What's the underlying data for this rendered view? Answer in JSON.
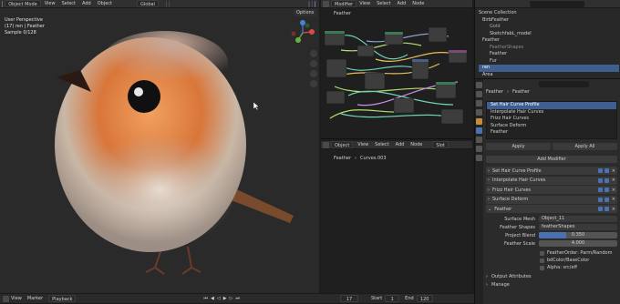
{
  "viewport": {
    "mode": "Object Mode",
    "menu": [
      "View",
      "Select",
      "Add",
      "Object"
    ],
    "transform": "Global",
    "options": "Options",
    "overlay": [
      "User Perspective",
      "(17) ren | Feather",
      "Sample 0/128"
    ]
  },
  "timeline": {
    "labels": [
      "View",
      "Marker",
      "Playback"
    ],
    "frame": "17",
    "start_label": "Start",
    "start": "1",
    "end_label": "End",
    "end": "120"
  },
  "node_editor_top": {
    "mode": "Modifier",
    "menu": [
      "View",
      "Select",
      "Add",
      "Node"
    ],
    "breadcrumb": "Feather"
  },
  "node_editor_bottom": {
    "mode": "Object",
    "menu": [
      "View",
      "Select",
      "Add",
      "Node"
    ],
    "slot": "Slot",
    "breadcrumb_a": "Feather",
    "breadcrumb_b": "Curves.003"
  },
  "outliner": {
    "items": [
      "Scene Collection",
      "BirbFeather",
      "Gold",
      "SketchfabL_model",
      "Feather",
      "FeatherShapes",
      "Feather",
      "Fur",
      "ren",
      "Area"
    ]
  },
  "properties": {
    "crumb_a": "Feather",
    "crumb_b": "Feather",
    "stack": [
      "Set Hair Curve Profile",
      "Interpolate Hair Curves",
      "Frizz Hair Curves",
      "Surface Deform",
      "Feather"
    ],
    "apply": "Apply",
    "apply_all": "Apply All",
    "add_modifier": "Add Modifier",
    "modifiers": [
      "Set Hair Curve Profile",
      "Interpolate Hair Curves",
      "Frizz Hair Curves",
      "Surface Deform",
      "Feather"
    ],
    "fields": [
      {
        "label": "Surface Mesh",
        "value": "Object_11"
      },
      {
        "label": "Feather Shapes",
        "value": "featherShapes"
      },
      {
        "label": "Project Blend",
        "value": "0.350"
      },
      {
        "label": "Feather Scale",
        "value": "4.000"
      }
    ],
    "project_blend_fraction": 0.35,
    "checks": [
      "FeatherOrder: Parm/Random",
      "bdColor/BaseColor",
      "Alpha: src/eff"
    ],
    "sections": [
      "Output Attributes",
      "Manage"
    ]
  },
  "colors": {
    "accent": "#4a72b0",
    "selected": "#3f5f91",
    "header": "#303030"
  }
}
